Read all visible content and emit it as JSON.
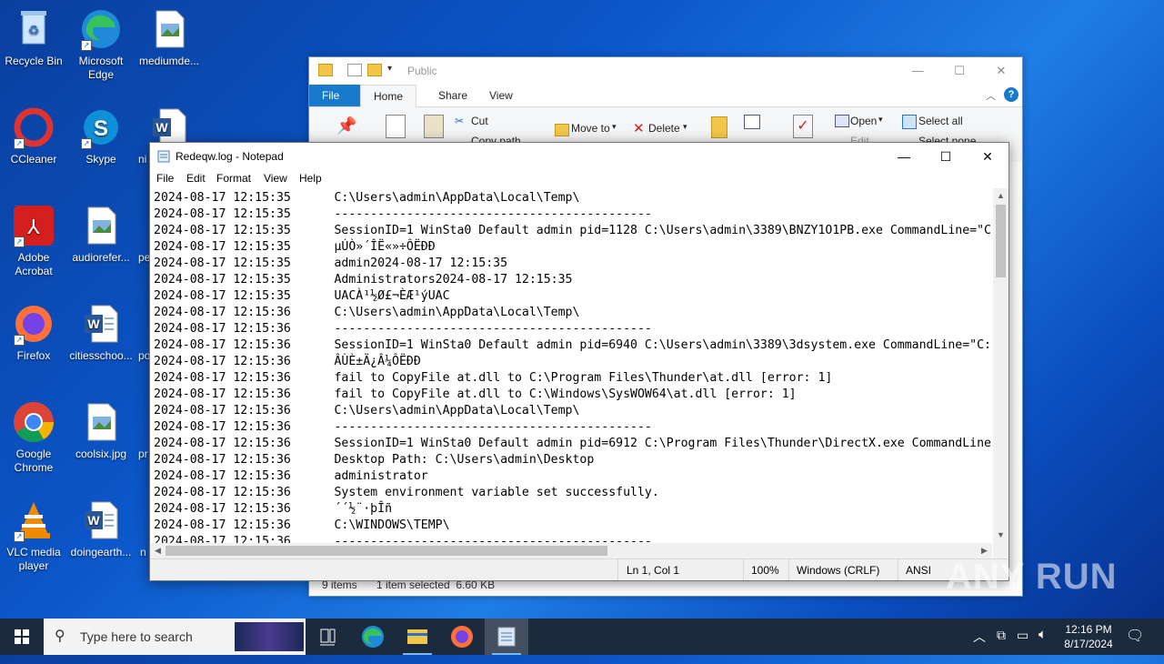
{
  "desktop": {
    "icons": [
      {
        "label": "Recycle Bin",
        "icon": "recycle-bin-icon"
      },
      {
        "label": "Microsoft Edge",
        "icon": "edge-icon"
      },
      {
        "label": "mediumde...",
        "icon": "image-file-icon"
      },
      {
        "label": "CCleaner",
        "icon": "ccleaner-icon"
      },
      {
        "label": "Skype",
        "icon": "skype-icon"
      },
      {
        "label": "ni",
        "icon": "word-doc-icon"
      },
      {
        "label": "Adobe Acrobat",
        "icon": "acrobat-icon"
      },
      {
        "label": "audiorefer...",
        "icon": "image-file-icon"
      },
      {
        "label": "pe",
        "icon": "file-icon"
      },
      {
        "label": "Firefox",
        "icon": "firefox-icon"
      },
      {
        "label": "citiesschoo...",
        "icon": "word-doc-icon"
      },
      {
        "label": "po",
        "icon": "file-icon"
      },
      {
        "label": "Google Chrome",
        "icon": "chrome-icon"
      },
      {
        "label": "coolsix.jpg",
        "icon": "image-file-icon"
      },
      {
        "label": "pr",
        "icon": "file-icon"
      },
      {
        "label": "VLC media player",
        "icon": "vlc-icon"
      },
      {
        "label": "doingearth...",
        "icon": "word-doc-icon"
      },
      {
        "label": "n",
        "icon": "file-icon"
      }
    ]
  },
  "explorer": {
    "title": "Public",
    "tabs": [
      "File",
      "Home",
      "Share",
      "View"
    ],
    "ribbon": {
      "cut": "Cut",
      "copy_path": "Copy path",
      "move_to": "Move to",
      "delete": "Delete",
      "open": "Open",
      "edit": "Edit",
      "select_all": "Select all",
      "select_none": "Select none"
    },
    "status": {
      "items": "9 items",
      "selected": "1 item selected  6.60 KB"
    }
  },
  "notepad": {
    "title": "Redeqw.log - Notepad",
    "menu": [
      "File",
      "Edit",
      "Format",
      "View",
      "Help"
    ],
    "lines": [
      "2024-08-17 12:15:35      C:\\Users\\admin\\AppData\\Local\\Temp\\",
      "2024-08-17 12:15:35      --------------------------------------------",
      "2024-08-17 12:15:35      SessionID=1 WinSta0 Default admin pid=1128 C:\\Users\\admin\\3389\\BNZY1O1PB.exe CommandLine=\"C",
      "2024-08-17 12:15:35      µÚÒ»´ÎË«»÷ÔËÐÐ",
      "2024-08-17 12:15:35      admin2024-08-17 12:15:35",
      "2024-08-17 12:15:35      Administrators2024-08-17 12:15:35",
      "2024-08-17 12:15:35      UACÀ¹½Ø£¬ÈÆ¹ýUAC",
      "2024-08-17 12:15:36      C:\\Users\\admin\\AppData\\Local\\Temp\\",
      "2024-08-17 12:15:36      --------------------------------------------",
      "2024-08-17 12:15:36      SessionID=1 WinSta0 Default admin pid=6940 C:\\Users\\admin\\3389\\3dsystem.exe CommandLine=\"C:",
      "2024-08-17 12:15:36      ÂÙÈ±Ä¿Â¼ÔËÐÐ",
      "2024-08-17 12:15:36      fail to CopyFile at.dll to C:\\Program Files\\Thunder\\at.dll [error: 1]",
      "2024-08-17 12:15:36      fail to CopyFile at.dll to C:\\Windows\\SysWOW64\\at.dll [error: 1]",
      "2024-08-17 12:15:36      C:\\Users\\admin\\AppData\\Local\\Temp\\",
      "2024-08-17 12:15:36      --------------------------------------------",
      "2024-08-17 12:15:36      SessionID=1 WinSta0 Default admin pid=6912 C:\\Program Files\\Thunder\\DirectX.exe CommandLine",
      "2024-08-17 12:15:36      Desktop Path: C:\\Users\\admin\\Desktop",
      "2024-08-17 12:15:36      administrator",
      "2024-08-17 12:15:36      System environment variable set successfully.",
      "2024-08-17 12:15:36      ´´½¨·þÎñ",
      "2024-08-17 12:15:36      C:\\WINDOWS\\TEMP\\",
      "2024-08-17 12:15:36      --------------------------------------------"
    ],
    "status": {
      "position": "Ln 1, Col 1",
      "zoom": "100%",
      "line_ending": "Windows (CRLF)",
      "encoding": "ANSI"
    }
  },
  "taskbar": {
    "search_placeholder": "Type here to search",
    "time": "12:16 PM",
    "date": "8/17/2024"
  },
  "watermark": "ANY RUN"
}
